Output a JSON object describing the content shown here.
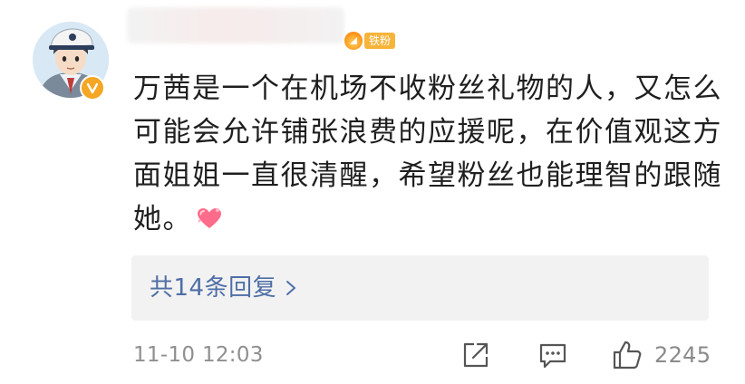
{
  "comment": {
    "fan_badge_label": "铁粉",
    "text": "万茜是一个在机场不收粉丝礼物的人，又怎么可能会允许铺张浪费的应援呢，在价值观这方面姐姐一直很清醒，希望粉丝也能理智的跟随她。",
    "emoji": "heart-emoji",
    "replies_label": "共14条回复",
    "timestamp": "11-10 12:03",
    "like_count": "2245"
  },
  "colors": {
    "link": "#4e6ea6",
    "meta_text": "#8f8f8f",
    "replies_bg": "#f2f2f2",
    "verified": "#f5a623",
    "fan_badge": "#f7b43b"
  },
  "icons": {
    "share": "share-icon",
    "comment": "comment-icon",
    "like": "thumbs-up-icon",
    "chevron": "chevron-right-icon",
    "verified": "verified-v-icon"
  }
}
